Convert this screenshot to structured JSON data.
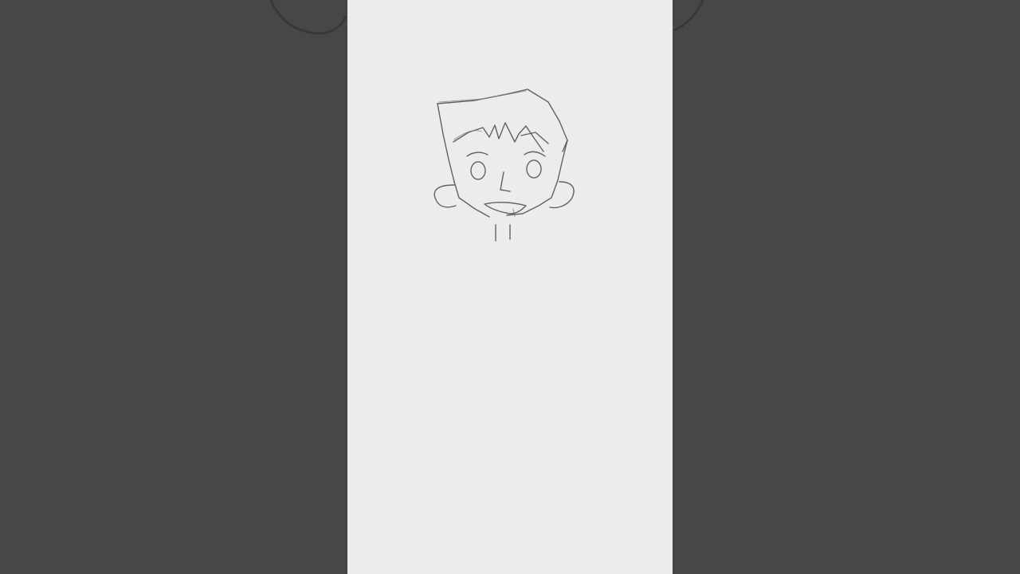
{
  "app": {
    "background_color": "#474747",
    "canvas_color": "#ececec",
    "stroke_color": "#4a4a4a"
  },
  "artwork": {
    "subject_icon": "pencil-sketch-boy-face-icon"
  }
}
